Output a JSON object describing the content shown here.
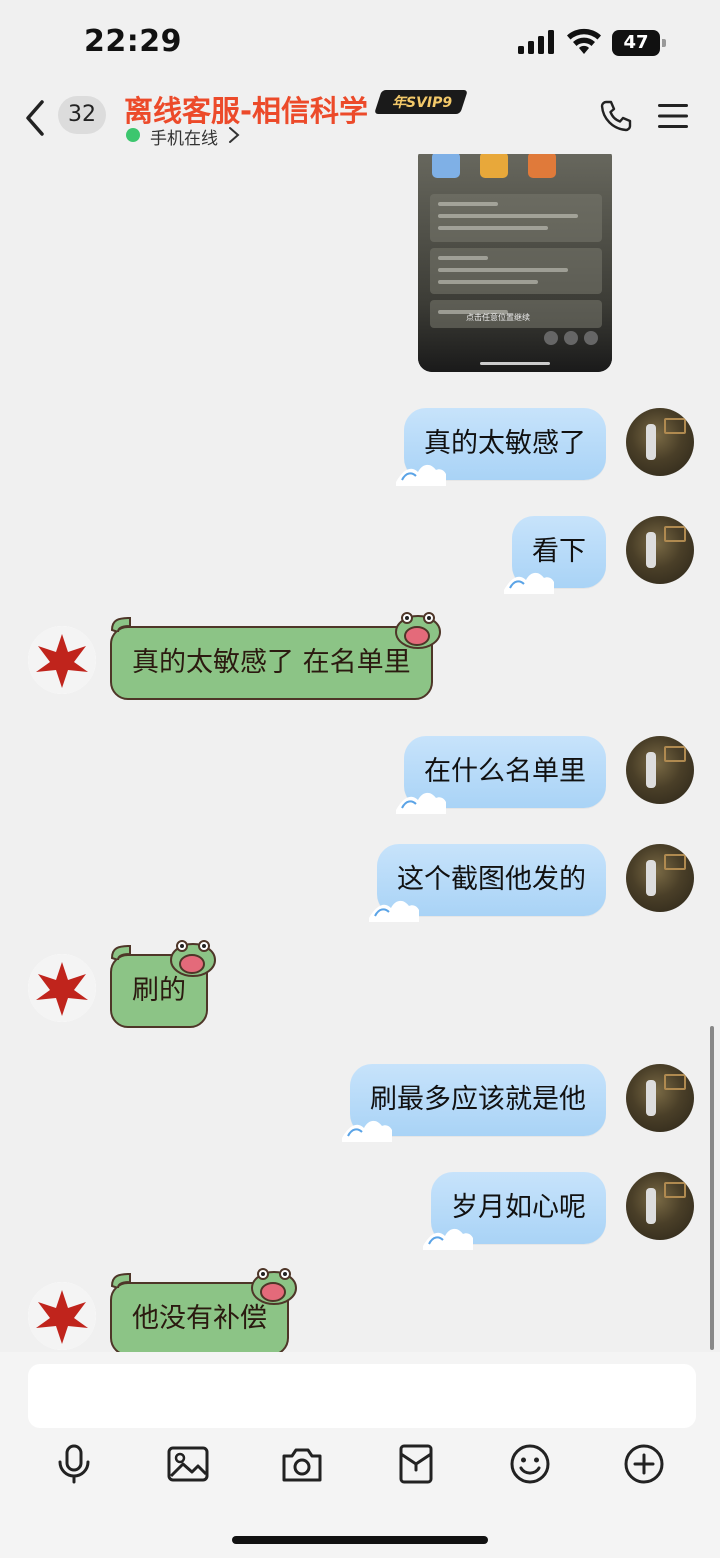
{
  "status_bar": {
    "time": "22:29",
    "battery": "47"
  },
  "header": {
    "unread_count": "32",
    "title": "离线客服-相信科学",
    "vip_badge": "年SVIP9",
    "status": "手机在线",
    "title_color": "#ec4a2a",
    "online_color": "#3cc66e"
  },
  "image_message": {
    "hint": "点击任意位置继续"
  },
  "messages": [
    {
      "sender": "self",
      "text": "真的太敏感了"
    },
    {
      "sender": "self",
      "text": "看下"
    },
    {
      "sender": "other",
      "text": "真的太敏感了 在名单里"
    },
    {
      "sender": "self",
      "text": "在什么名单里"
    },
    {
      "sender": "self",
      "text": "这个截图他发的"
    },
    {
      "sender": "other",
      "text": "刷的"
    },
    {
      "sender": "self",
      "text": "刷最多应该就是他"
    },
    {
      "sender": "self",
      "text": "岁月如心呢"
    },
    {
      "sender": "other",
      "text": "他没有补偿"
    }
  ],
  "toolbar": {
    "icons": [
      "microphone-icon",
      "image-icon",
      "camera-icon",
      "red-packet-icon",
      "emoji-icon",
      "plus-icon"
    ]
  },
  "colors": {
    "outgoing_bubble": "#a9d3f6",
    "incoming_bubble": "#8cc486"
  }
}
